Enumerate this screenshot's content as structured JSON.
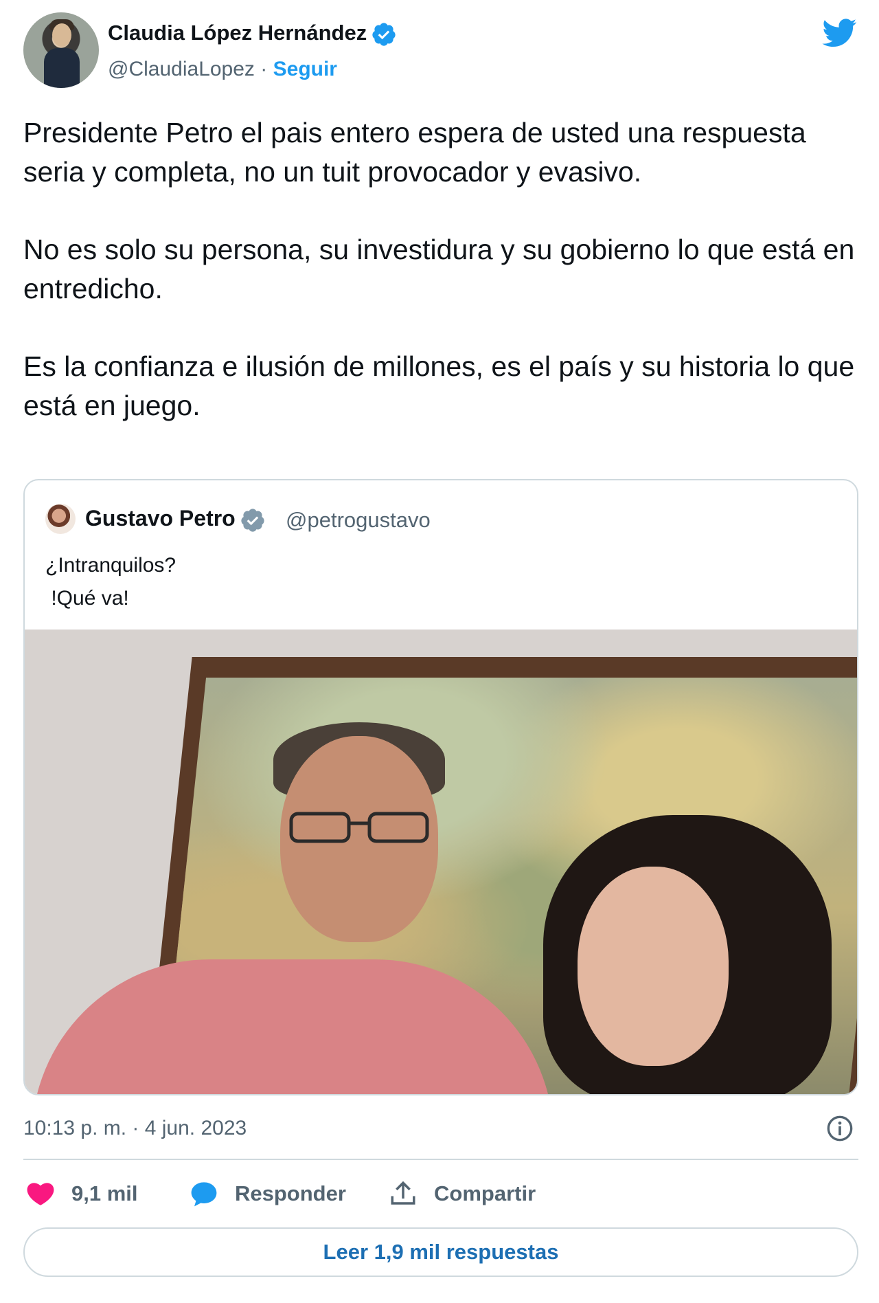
{
  "author": {
    "name": "Claudia López Hernández",
    "handle": "@ClaudiaLopez",
    "separator": "·",
    "follow": "Seguir"
  },
  "tweet": {
    "paragraphs": [
      "Presidente Petro el pais entero espera de usted una respuesta seria y completa, no un tuit provocador y evasivo.",
      "No es solo su persona, su investidura y su gobierno lo que está en entredicho.",
      "Es la confianza e ilusión de millones, es el país y su historia lo que está en juego."
    ]
  },
  "quoted": {
    "name": "Gustavo Petro",
    "handle": "@petrogustavo",
    "lines": [
      "¿Intranquilos?",
      " !Qué va!"
    ]
  },
  "meta": {
    "timestamp": "10:13 p. m. · 4 jun. 2023"
  },
  "actions": {
    "likes": "9,1 mil",
    "reply": "Responder",
    "share": "Compartir"
  },
  "footer": {
    "read_replies": "Leer 1,9 mil respuestas"
  },
  "colors": {
    "accent": "#1d9bf0",
    "like": "#f91880",
    "muted": "#536471"
  }
}
